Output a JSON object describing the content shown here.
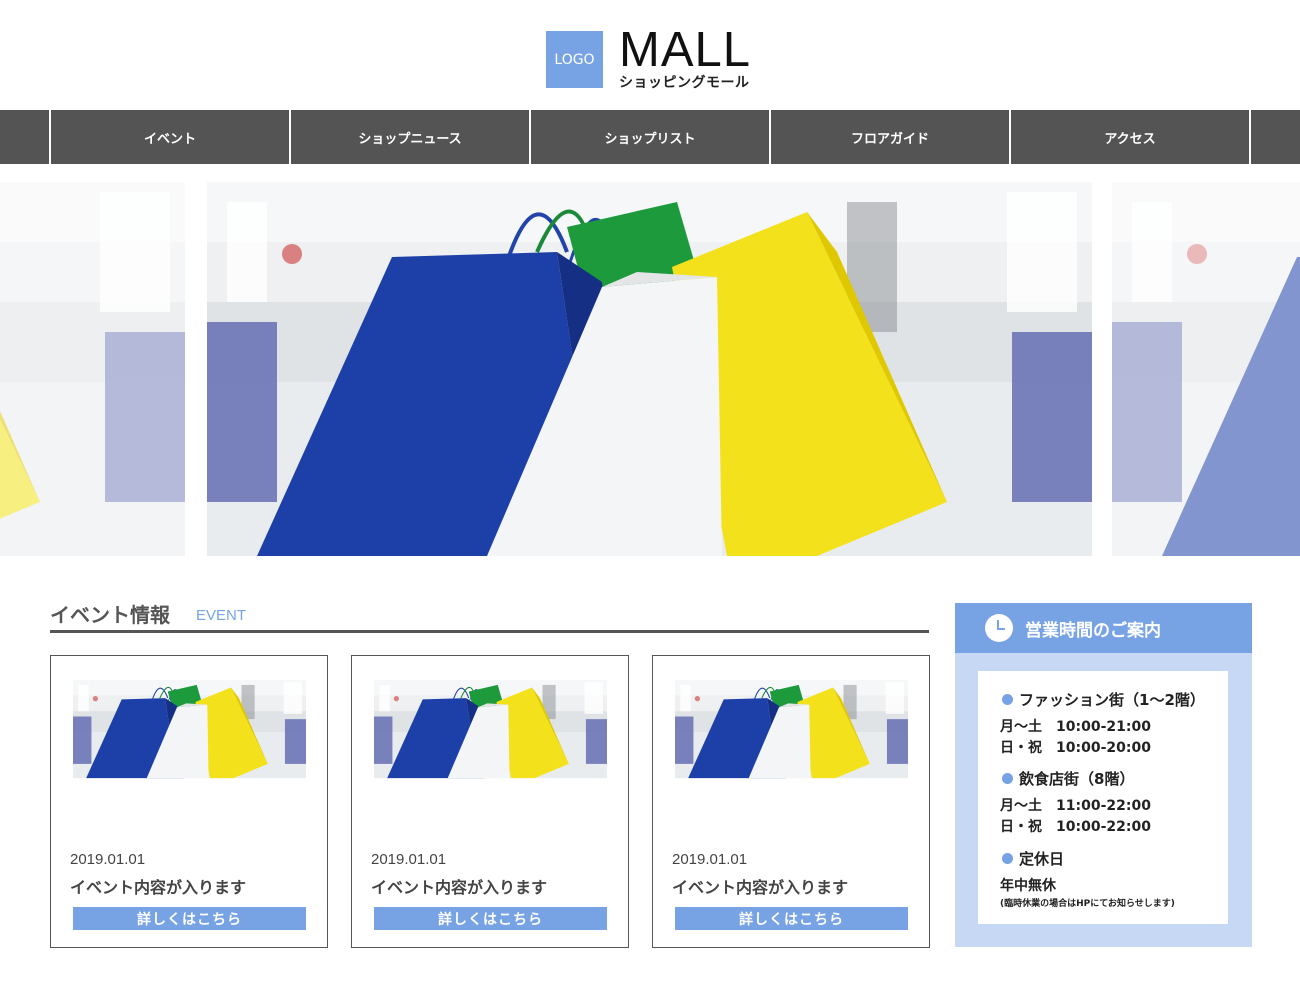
{
  "header": {
    "logo_label": "LOGO",
    "brand_title": "MALL",
    "brand_subtitle": "ショッピングモール"
  },
  "nav": {
    "items": [
      {
        "label": "イベント"
      },
      {
        "label": "ショップニュース"
      },
      {
        "label": "ショップリスト"
      },
      {
        "label": "フロアガイド"
      },
      {
        "label": "アクセス"
      }
    ]
  },
  "events": {
    "title": "イベント情報",
    "subtitle": "EVENT",
    "cards": [
      {
        "date": "2019.01.01",
        "text": "イベント内容が入ります",
        "button": "詳しくはこちら"
      },
      {
        "date": "2019.01.01",
        "text": "イベント内容が入ります",
        "button": "詳しくはこちら"
      },
      {
        "date": "2019.01.01",
        "text": "イベント内容が入ります",
        "button": "詳しくはこちら"
      }
    ]
  },
  "hours": {
    "title": "営業時間のご案内",
    "sections": [
      {
        "name": "ファッション街（1〜2階）",
        "rows": [
          {
            "days": "月〜土",
            "time": "10:00-21:00"
          },
          {
            "days": "日・祝",
            "time": "10:00-20:00"
          }
        ]
      },
      {
        "name": "飲食店街（8階）",
        "rows": [
          {
            "days": "月〜土",
            "time": "11:00-22:00"
          },
          {
            "days": "日・祝",
            "time": "10:00-22:00"
          }
        ]
      }
    ],
    "holiday": {
      "name": "定休日",
      "value": "年中無休",
      "note": "(臨時休業の場合はHPにてお知らせします)"
    }
  },
  "colors": {
    "accent": "#77a3e4",
    "nav_bg": "#545454",
    "hours_bg": "#c6d8f3"
  }
}
